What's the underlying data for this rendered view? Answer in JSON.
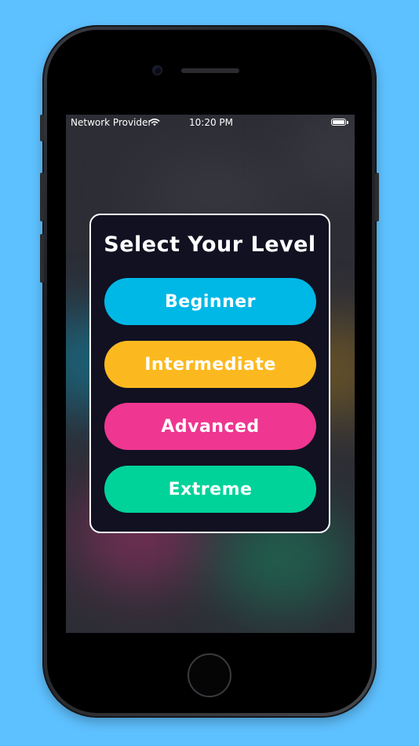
{
  "status_bar": {
    "carrier": "Network Provider",
    "time": "10:20 PM",
    "wifi_icon": "wifi-icon",
    "battery_icon": "battery-icon",
    "battery_level": 1.0
  },
  "dialog": {
    "title": "Select Your Level",
    "levels": [
      {
        "label": "Beginner",
        "color": "#00b8e6"
      },
      {
        "label": "Intermediate",
        "color": "#fcb91f"
      },
      {
        "label": "Advanced",
        "color": "#ef3690"
      },
      {
        "label": "Extreme",
        "color": "#00d39a"
      }
    ]
  },
  "colors": {
    "background": "#5ec1ff",
    "dialog_background": "#111122",
    "dialog_border": "#ffffff"
  }
}
